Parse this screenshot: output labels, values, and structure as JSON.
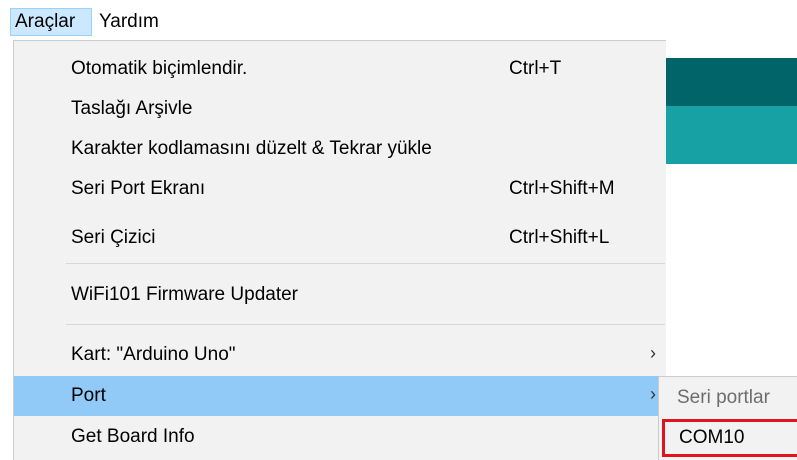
{
  "menubar": {
    "items": [
      {
        "label": "Araçlar"
      },
      {
        "label": "Yardım"
      }
    ]
  },
  "tools_menu": {
    "items": [
      {
        "label": "Otomatik biçimlendir.",
        "shortcut": "Ctrl+T"
      },
      {
        "label": "Taslağı Arşivle",
        "shortcut": ""
      },
      {
        "label": "Karakter kodlamasını düzelt & Tekrar yükle",
        "shortcut": ""
      },
      {
        "label": "Seri Port Ekranı",
        "shortcut": "Ctrl+Shift+M"
      },
      {
        "label": "Seri Çizici",
        "shortcut": "Ctrl+Shift+L"
      },
      {
        "label": "WiFi101 Firmware Updater",
        "shortcut": ""
      },
      {
        "label": "Kart: \"Arduino Uno\"",
        "arrow": "›"
      },
      {
        "label": "Port",
        "arrow": "›"
      },
      {
        "label": "Get Board Info"
      }
    ]
  },
  "port_submenu": {
    "header": "Seri portlar",
    "items": [
      {
        "label": "COM10"
      }
    ]
  },
  "colors": {
    "highlight": "#91c9f7",
    "menu_bg": "#f2f2f2",
    "teal_dark": "#006468",
    "teal_light": "#17a1a5",
    "selection_border": "#e0141e"
  }
}
